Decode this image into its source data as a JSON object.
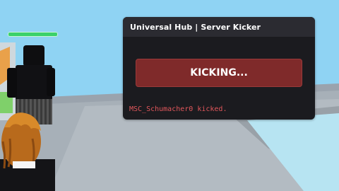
{
  "player": {
    "health": 1.0
  },
  "kicker": {
    "title": "Universal Hub | Server Kicker",
    "button_label": "KICKING...",
    "status_text": "MSC_Schumacher0 kicked."
  },
  "colors": {
    "panel_bg": "#1b1b1f",
    "header_bg": "#2b2b31",
    "button_bg": "#7f2a2a",
    "status_red": "#e0575b",
    "health_green": "#3ad16a"
  }
}
